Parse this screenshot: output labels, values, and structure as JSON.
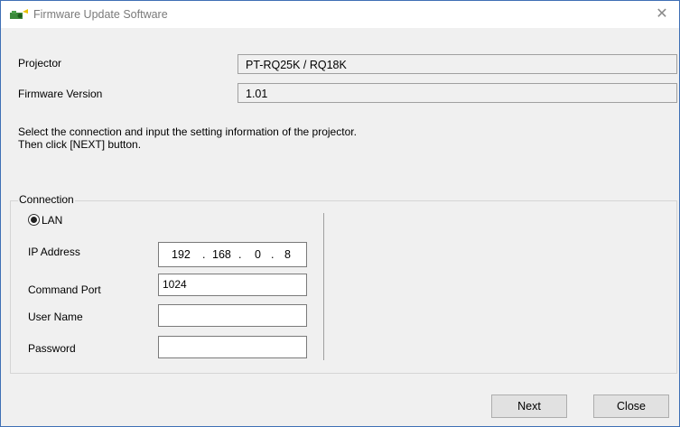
{
  "window": {
    "title": "Firmware Update Software"
  },
  "fields": {
    "projector_label": "Projector",
    "projector_value": "PT-RQ25K / RQ18K",
    "firmware_label": "Firmware Version",
    "firmware_value": "1.01"
  },
  "instructions": {
    "line1": "Select the connection and input the setting information of the projector.",
    "line2": "Then click [NEXT] button."
  },
  "connection": {
    "legend": "Connection",
    "lan_label": "LAN",
    "lan_selected": true,
    "ip_label": "IP Address",
    "ip": [
      "192",
      "168",
      "0",
      "8"
    ],
    "ip_separator": ".",
    "port_label": "Command Port",
    "port_value": "1024",
    "user_label": "User Name",
    "user_value": "",
    "password_label": "Password",
    "password_value": ""
  },
  "buttons": {
    "next": "Next",
    "close": "Close"
  },
  "icons": {
    "title_icon": "projector-icon",
    "close": "close-icon"
  }
}
